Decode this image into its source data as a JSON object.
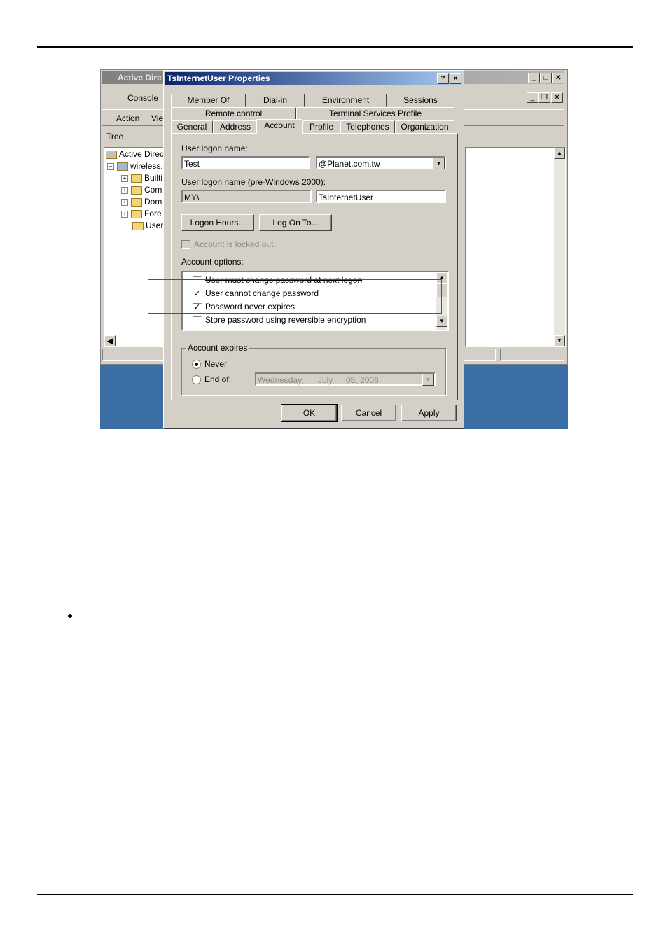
{
  "bg_window": {
    "title": "Active Dire",
    "console_menu": "Console",
    "action_menu": "Action",
    "view_menu": "Viev",
    "tree_tab": "Tree",
    "tree_items": [
      "Active Direct",
      "wireless.",
      "Builti",
      "Com",
      "Dom",
      "Fore",
      "User"
    ]
  },
  "dialog": {
    "title": "TsInternetUser Properties",
    "help_btn": "?",
    "close_btn": "×",
    "tabs_row1": [
      "Member Of",
      "Dial-in",
      "Environment",
      "Sessions"
    ],
    "tabs_row2": [
      "Remote control",
      "Terminal Services Profile"
    ],
    "tabs_row3": [
      "General",
      "Address",
      "Account",
      "Profile",
      "Telephones",
      "Organization"
    ],
    "active_tab": "Account",
    "logon_name_label": "User logon name:",
    "logon_name_value": "Test",
    "domain_value": "@Planet.com.tw",
    "pre2000_label": "User logon name (pre-Windows 2000):",
    "pre2000_domain": "MY\\",
    "pre2000_value": "TsInternetUser",
    "logon_hours_btn": "Logon Hours...",
    "log_on_to_btn": "Log On To...",
    "locked_out_label": "Account is locked out",
    "account_options_label": "Account options:",
    "options": [
      {
        "label": "User must change password at next logon",
        "checked": false
      },
      {
        "label": "User cannot change password",
        "checked": true
      },
      {
        "label": "Password never expires",
        "checked": true
      },
      {
        "label": "Store password using reversible encryption",
        "checked": false
      }
    ],
    "account_expires_label": "Account expires",
    "never_label": "Never",
    "end_of_label": "End of:",
    "end_date_day": "Wednesday,",
    "end_date_month": "July",
    "end_date_rest": "05, 2006",
    "ok_btn": "OK",
    "cancel_btn": "Cancel",
    "apply_btn": "Apply"
  },
  "colors": {
    "highlight_box": "#e0141e",
    "title_active": "#0a246a",
    "desktop": "#3a6ea5"
  }
}
